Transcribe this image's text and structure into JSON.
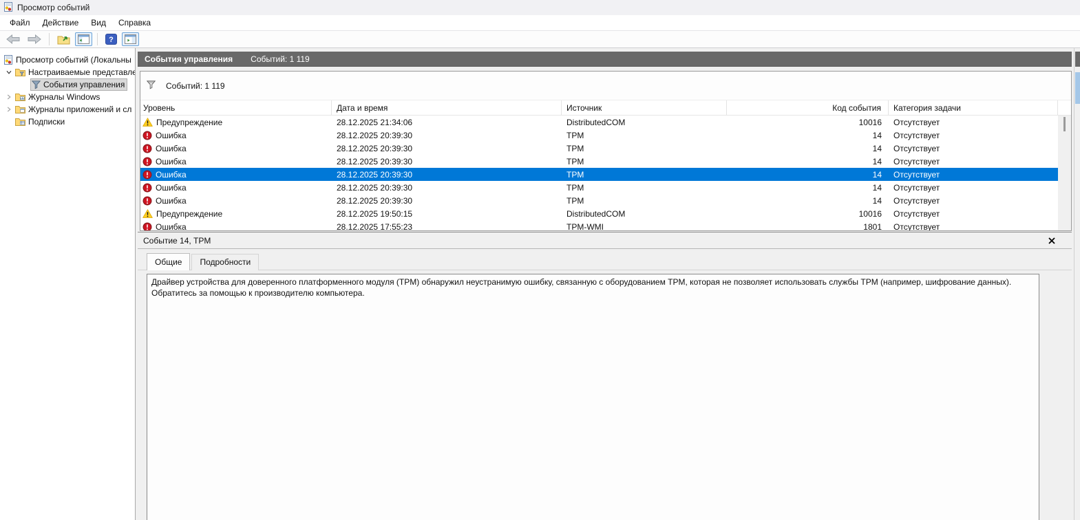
{
  "window": {
    "title": "Просмотр событий"
  },
  "menu": {
    "items": [
      "Файл",
      "Действие",
      "Вид",
      "Справка"
    ]
  },
  "toolbar": {
    "icons": [
      "back-arrow",
      "forward-arrow",
      "export-log",
      "toggle-console-tree",
      "help",
      "toggle-action-pane"
    ]
  },
  "tree": {
    "items": [
      {
        "label": "Просмотр событий (Локальны",
        "indent": 0,
        "chevron": "none",
        "icon": "event-viewer",
        "selected": false
      },
      {
        "label": "Настраиваемые представле",
        "indent": 1,
        "chevron": "expanded",
        "icon": "folder-filter",
        "selected": false
      },
      {
        "label": "События управления",
        "indent": 2,
        "chevron": "none",
        "icon": "filter",
        "selected": true
      },
      {
        "label": "Журналы Windows",
        "indent": 1,
        "chevron": "collapsed",
        "icon": "folder-log",
        "selected": false
      },
      {
        "label": "Журналы приложений и сл",
        "indent": 1,
        "chevron": "collapsed",
        "icon": "folder-apps",
        "selected": false
      },
      {
        "label": "Подписки",
        "indent": 1,
        "chevron": "none",
        "icon": "folder-subscriptions",
        "selected": false
      }
    ]
  },
  "main": {
    "panel_title": "События управления",
    "panel_count": "Событий: 1 119",
    "filter_count": "Событий: 1 119",
    "table": {
      "columns": [
        "Уровень",
        "Дата и время",
        "Источник",
        "Код события",
        "Категория задачи"
      ],
      "rows": [
        {
          "icon": "warning",
          "level": "Предупреждение",
          "datetime": "28.12.2025 21:34:06",
          "source": "DistributedCOM",
          "event_id": "10016",
          "category": "Отсутствует",
          "selected": false
        },
        {
          "icon": "error",
          "level": "Ошибка",
          "datetime": "28.12.2025 20:39:30",
          "source": "TPM",
          "event_id": "14",
          "category": "Отсутствует",
          "selected": false
        },
        {
          "icon": "error",
          "level": "Ошибка",
          "datetime": "28.12.2025 20:39:30",
          "source": "TPM",
          "event_id": "14",
          "category": "Отсутствует",
          "selected": false
        },
        {
          "icon": "error",
          "level": "Ошибка",
          "datetime": "28.12.2025 20:39:30",
          "source": "TPM",
          "event_id": "14",
          "category": "Отсутствует",
          "selected": false
        },
        {
          "icon": "error",
          "level": "Ошибка",
          "datetime": "28.12.2025 20:39:30",
          "source": "TPM",
          "event_id": "14",
          "category": "Отсутствует",
          "selected": true
        },
        {
          "icon": "error",
          "level": "Ошибка",
          "datetime": "28.12.2025 20:39:30",
          "source": "TPM",
          "event_id": "14",
          "category": "Отсутствует",
          "selected": false
        },
        {
          "icon": "error",
          "level": "Ошибка",
          "datetime": "28.12.2025 20:39:30",
          "source": "TPM",
          "event_id": "14",
          "category": "Отсутствует",
          "selected": false
        },
        {
          "icon": "warning",
          "level": "Предупреждение",
          "datetime": "28.12.2025 19:50:15",
          "source": "DistributedCOM",
          "event_id": "10016",
          "category": "Отсутствует",
          "selected": false
        },
        {
          "icon": "error",
          "level": "Ошибка",
          "datetime": "28.12.2025 17:55:23",
          "source": "TPM-WMI",
          "event_id": "1801",
          "category": "Отсутствует",
          "selected": false
        }
      ]
    }
  },
  "detail": {
    "title": "Событие 14, TPM",
    "tabs": [
      {
        "label": "Общие",
        "active": true
      },
      {
        "label": "Подробности",
        "active": false
      }
    ],
    "description_lines": [
      "Драйвер устройства для доверенного платформенного модуля (TPM) обнаружил неустранимую ошибку, связанную с оборудованием TPM, которая не позволяет использовать службы TPM (например, шифрование данных).",
      "Обратитесь за помощью к производителю компьютера."
    ]
  },
  "colors": {
    "selection_blue": "#0078d7",
    "panel_header_gray": "#696969",
    "error_red": "#d11422",
    "warning_yellow": "#f6c514",
    "folder_yellow": "#ffd977"
  }
}
